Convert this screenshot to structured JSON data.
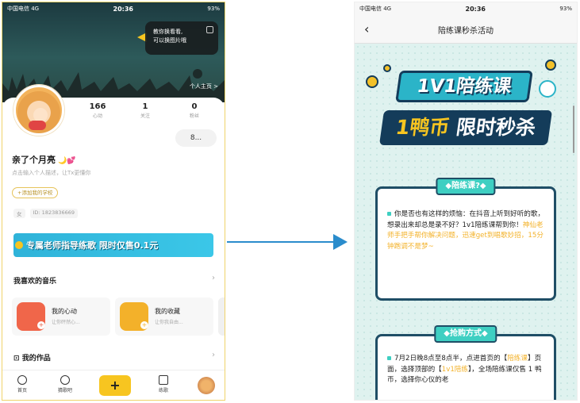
{
  "left": {
    "status": {
      "carrier": "中国电信 4G",
      "time": "20:36",
      "battery": "93%"
    },
    "tooltip": {
      "line1": "教你换看看,",
      "line2": "可以换图片哦"
    },
    "home_link": "个人主页 >",
    "stats": [
      {
        "value": "166",
        "label": "心动"
      },
      {
        "value": "1",
        "label": "关注"
      },
      {
        "value": "0",
        "label": "粉丝"
      }
    ],
    "more_button": "8...",
    "username": "亲了个月亮",
    "username_emoji": "🌙💕",
    "intro_hint": "点击输入个人描述，让Tx更懂你",
    "school_button": "+添加我的学校",
    "gender": "女",
    "user_id": "ID: 1823836669",
    "banner_text": "专属老师指导练歌  限时仅售0.1元",
    "my_music": "我喜欢的音乐",
    "tiles": [
      {
        "title": "我的心动",
        "sub": "让你砰然心..."
      },
      {
        "title": "我的收藏",
        "sub": "让你我自由..."
      }
    ],
    "works": "我的作品",
    "nav": [
      "首页",
      "猜歌吧",
      "+",
      "练歌",
      ""
    ],
    "colors": {
      "accent": "#f7c520",
      "banner": "#2fb3d9",
      "tile1": "#f0664a",
      "tile2": "#f3b12a"
    }
  },
  "right": {
    "status": {
      "carrier": "中国电信 4G",
      "time": "20:36",
      "battery": "93%"
    },
    "nav_title": "陪练课秒杀活动",
    "poster": {
      "line1": "1V1陪练课",
      "line2a": "1鸭币",
      "line2b": "限时秒杀"
    },
    "panel1": {
      "tag": "◆陪练课?◆",
      "text_black": "你是否也有这样的烦恼：在抖音上听到好听的歌，想录出来却总是录不好？1v1陪练课帮到你！",
      "text_orange": "神仙老师手把手帮你解决问题，迅速get到唱歌妙招，15分钟跑调不是梦~"
    },
    "panel2": {
      "tag": "◆抢购方式◆",
      "text_a": "7月2日晚8点至8点半，点进首页的【",
      "text_b": "陪练课",
      "text_c": "】页面，选择顶部的【",
      "text_d": "1v1陪练",
      "text_e": "】，全场陪练课仅售 1 鸭币，选择你心仪的老"
    },
    "colors": {
      "teal": "#3ecfc2",
      "navy": "#1f4e66",
      "orange": "#f3b22a"
    }
  }
}
